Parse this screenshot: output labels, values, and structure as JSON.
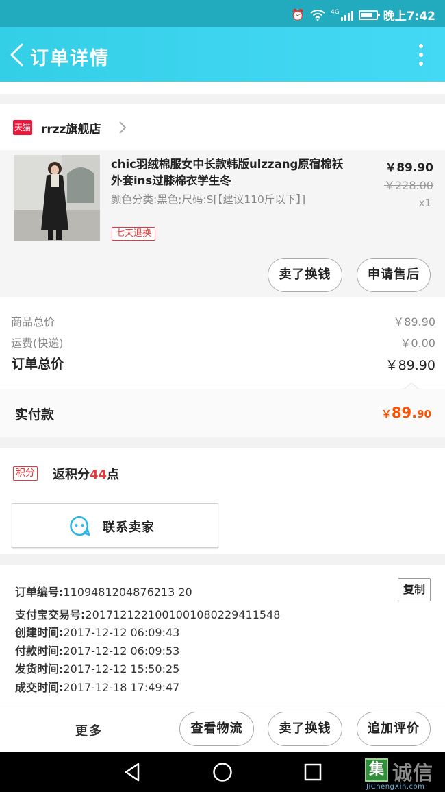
{
  "status_bar": {
    "time": "晚上7:42",
    "network": "4G",
    "icons": [
      "alarm-icon",
      "wifi-icon",
      "signal-icon",
      "battery-icon"
    ]
  },
  "header": {
    "title": "订单详情",
    "back_icon": "chevron-left-icon",
    "more_icon": "more-vertical-icon",
    "gradient": "#3fd5f0"
  },
  "shop": {
    "logo_text": "天猫",
    "name": "rrzz旗舰店",
    "logo_color": "#e8193c"
  },
  "product": {
    "title": "chic羽绒棉服女中长款韩版ulzzang原宿棉袄外套ins过膝棉衣学生冬",
    "sku": "颜色分类:黑色;尺码:S[【建议110斤以下】]",
    "badge": "七天退换",
    "price": "￥89.90",
    "original_price": "￥228.00",
    "quantity": "x1"
  },
  "item_actions": {
    "sell_label": "卖了换钱",
    "after_sale_label": "申请售后"
  },
  "price_summary": {
    "goods_label": "商品总价",
    "goods_value": "￥89.90",
    "shipping_label": "运费(快递)",
    "shipping_value": "￥0.00",
    "total_label": "订单总价",
    "total_value": "￥89.90",
    "paid_label": "实付款",
    "paid_currency": "￥",
    "paid_int": "89.",
    "paid_dec": "90",
    "accent": "#ff5000"
  },
  "points": {
    "badge": "积分",
    "prefix": "返积分",
    "value": "44",
    "suffix": "点"
  },
  "contact": {
    "label": "联系卖家",
    "icon": "chat-face-icon"
  },
  "order_info": {
    "copy_label": "复制",
    "lines": [
      {
        "key": "订单编号:",
        "value": "1109481204876213 20"
      },
      {
        "key": "支付宝交易号:",
        "value": "2017121221001001080229411548"
      },
      {
        "key": "创建时间:",
        "value": "2017-12-12 06:09:43"
      },
      {
        "key": "付款时间:",
        "value": "2017-12-12 06:09:53"
      },
      {
        "key": "发货时间:",
        "value": "2017-12-12 15:50:25"
      },
      {
        "key": "成交时间:",
        "value": "2017-12-18 17:49:47"
      }
    ]
  },
  "bottom_bar": {
    "more_label": "更多",
    "logistics_label": "查看物流",
    "sell_label": "卖了换钱",
    "review_label": "追加评价"
  },
  "nav_bar": {
    "icons": [
      "back-triangle-icon",
      "home-circle-icon",
      "recents-square-icon"
    ]
  },
  "watermark": {
    "mark": "集",
    "cn": "诚信",
    "en": "JiChengXin.com"
  }
}
